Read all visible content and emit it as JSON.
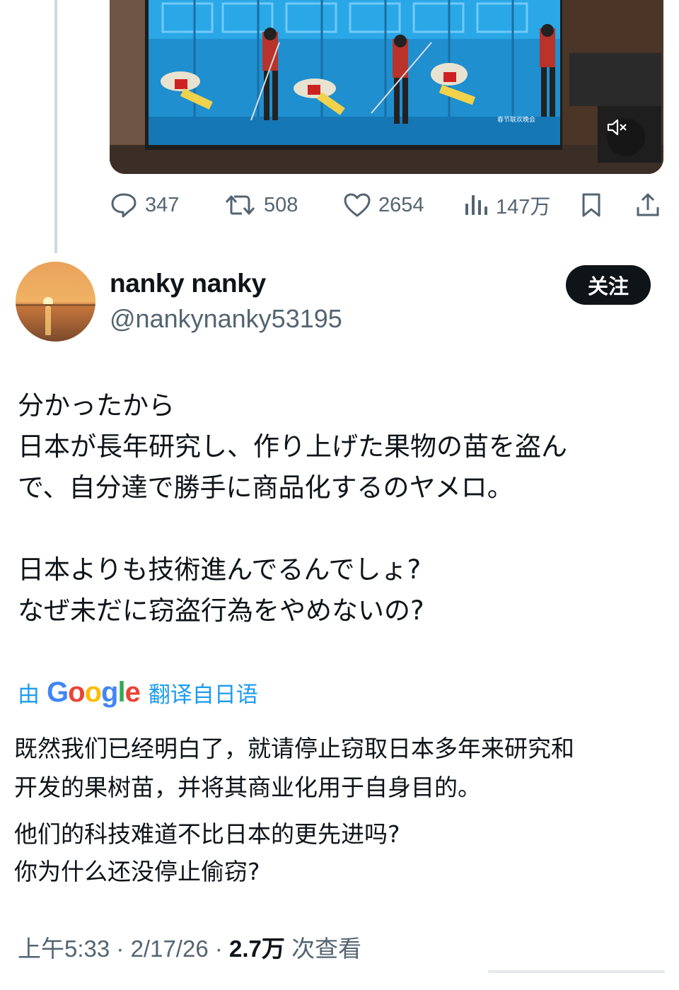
{
  "video": {
    "muted_icon": "volume-muted-icon",
    "caption_watermark": "春节联欢晚会"
  },
  "actions": {
    "replies": "347",
    "reposts": "508",
    "likes": "2654",
    "views": "147万",
    "bookmark_icon": "bookmark-icon",
    "share_icon": "share-icon"
  },
  "author": {
    "name": "nanky nanky",
    "handle": "@nankynanky53195",
    "follow_label": "关注"
  },
  "tweet": {
    "original": [
      "分かったから",
      "日本が長年研究し、作り上げた果物の苗を盗ん",
      "で、自分達で勝手に商品化するのヤメロ。",
      "",
      "日本よりも技術進んでるんでしょ?",
      "なぜ未だに窃盗行為をやめないの?"
    ],
    "translation_prefix": "由",
    "translation_provider": "Google",
    "translation_suffix": "翻译自日语",
    "translated": [
      "既然我们已经明白了，就请停止窃取日本多年来研究和",
      "开发的果树苗，并将其商业化用于自身目的。",
      "他们的科技难道不比日本的更先进吗?",
      "你为什么还没停止偷窃?"
    ]
  },
  "meta": {
    "time": "上午5:33",
    "date": "2/17/26",
    "views_count": "2.7万",
    "views_label": "次查看",
    "separator": "·"
  },
  "colors": {
    "text": "#0f1419",
    "secondary": "#536471",
    "link": "#1d9bf0",
    "follow_bg": "#0f1419"
  }
}
